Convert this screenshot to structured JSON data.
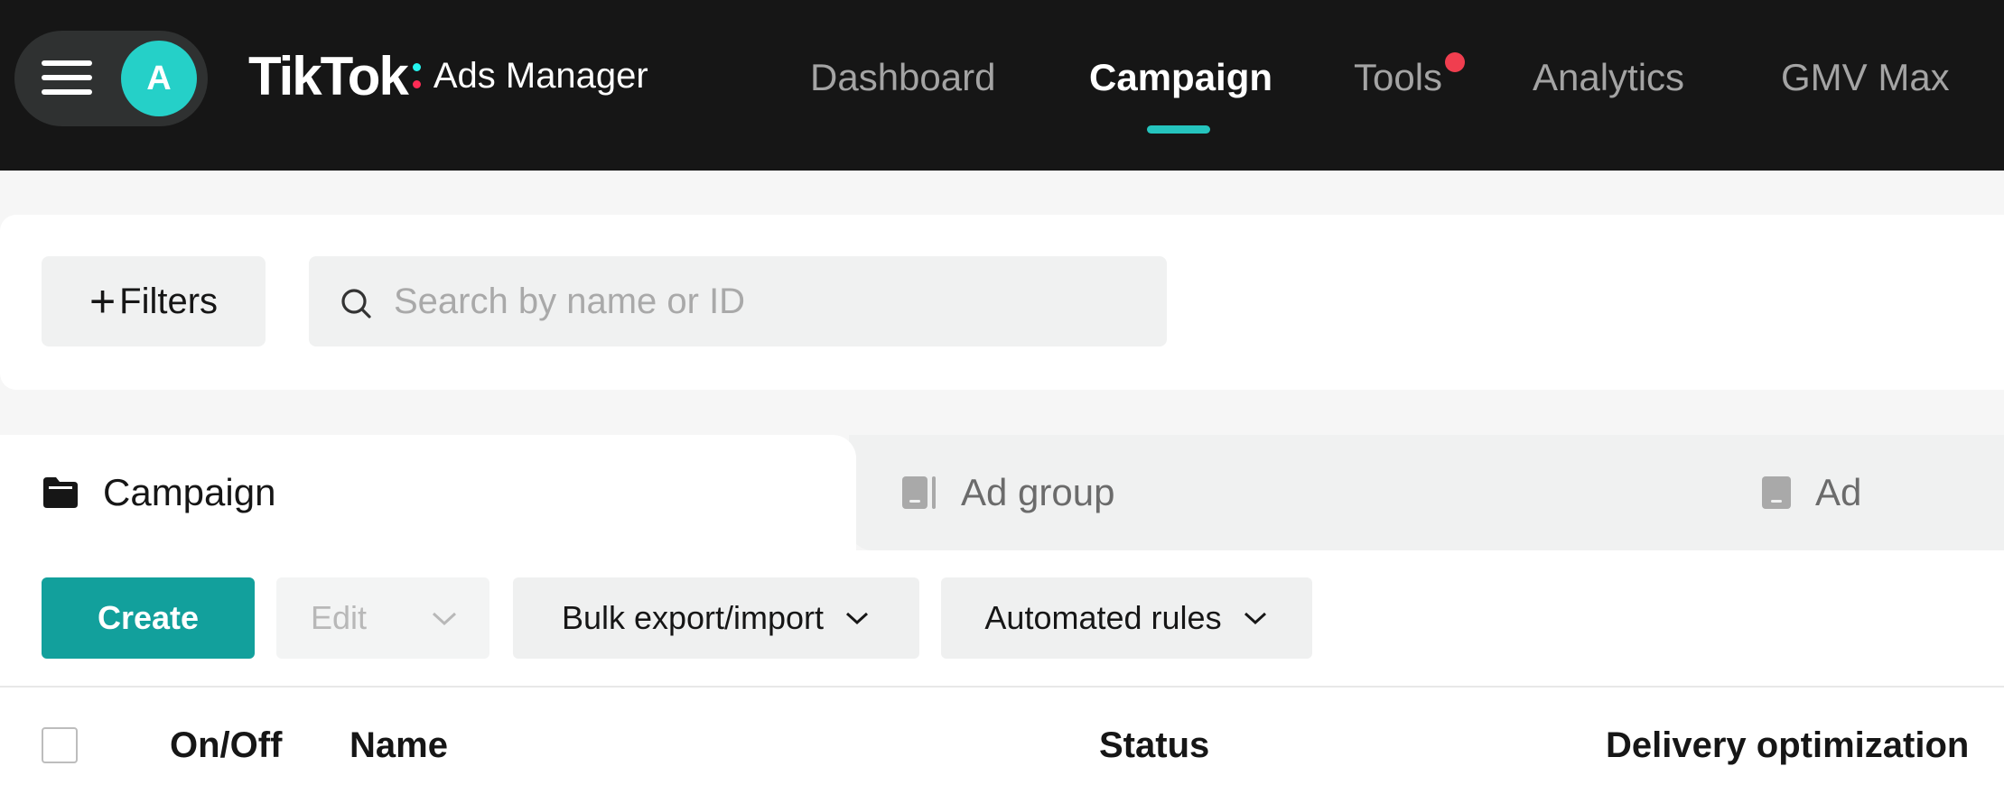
{
  "header": {
    "avatar_initial": "A",
    "logo_brand": "TikTok",
    "logo_product": "Ads Manager",
    "logo_colon_colors": [
      "#25f4ee",
      "#fe2c55"
    ],
    "nav": [
      {
        "label": "Dashboard",
        "active": false
      },
      {
        "label": "Campaign",
        "active": true
      },
      {
        "label": "Tools",
        "active": false,
        "has_notification": true
      },
      {
        "label": "Analytics",
        "active": false
      },
      {
        "label": "GMV Max",
        "active": false
      }
    ]
  },
  "filters": {
    "filters_label": "Filters",
    "search_placeholder": "Search by name or ID",
    "search_value": ""
  },
  "level_tabs": [
    {
      "label": "Campaign",
      "icon": "folder-icon",
      "active": true
    },
    {
      "label": "Ad group",
      "icon": "ad-group-icon",
      "active": false
    },
    {
      "label": "Ad",
      "icon": "ad-icon",
      "active": false
    }
  ],
  "toolbar": {
    "create_label": "Create",
    "edit_label": "Edit",
    "edit_disabled": true,
    "bulk_label": "Bulk export/import",
    "rules_label": "Automated rules"
  },
  "table": {
    "columns": [
      "On/Off",
      "Name",
      "Status",
      "Delivery optimization"
    ]
  },
  "colors": {
    "topbar_bg": "#161616",
    "accent_teal": "#12a09c",
    "avatar_bg": "#25d0c8",
    "nav_underline": "#25c4be",
    "notification": "#f03e4f"
  }
}
